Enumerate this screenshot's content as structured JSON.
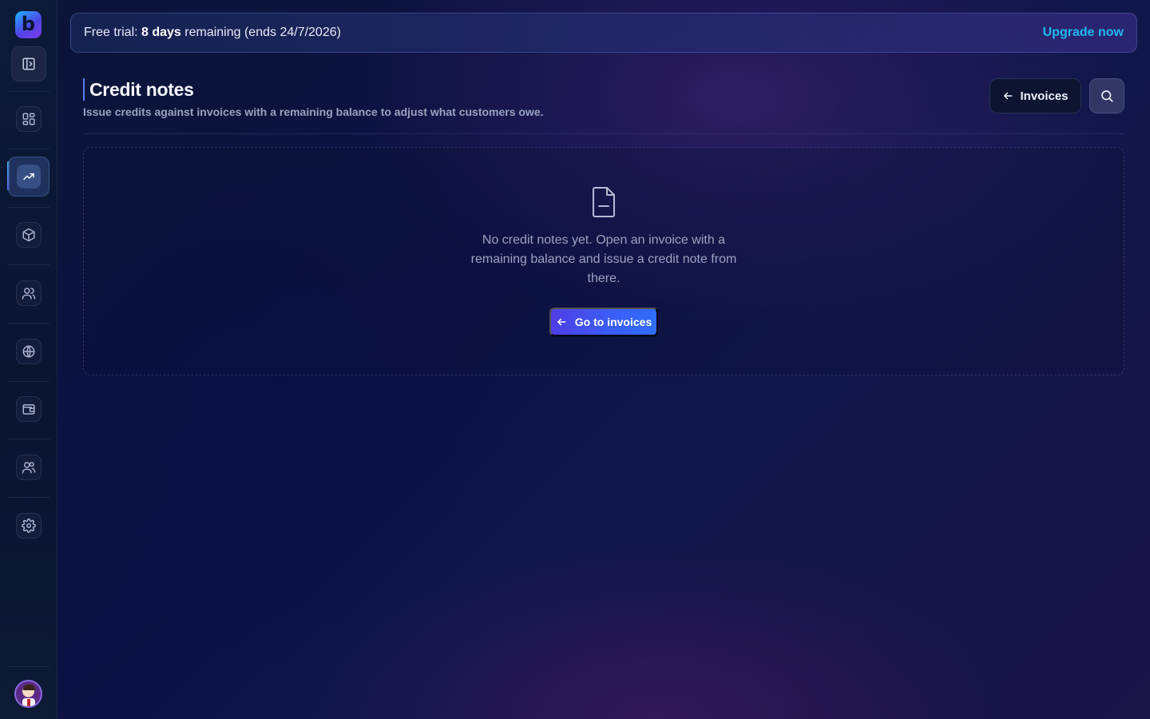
{
  "brand": {
    "logo_letter": "b"
  },
  "sidebar": {
    "items": [
      {
        "icon": "dashboard-icon"
      },
      {
        "icon": "trending-up-icon",
        "active": true
      },
      {
        "icon": "package-icon"
      },
      {
        "icon": "users-icon"
      },
      {
        "icon": "globe-icon"
      },
      {
        "icon": "wallet-icon"
      },
      {
        "icon": "team-icon"
      },
      {
        "icon": "settings-icon"
      }
    ]
  },
  "banner": {
    "prefix": "Free trial: ",
    "days": "8 days",
    "suffix": " remaining (ends 24/7/2026)",
    "upgrade_label": "Upgrade now"
  },
  "header": {
    "title": "Credit notes",
    "subtitle": "Issue credits against invoices with a remaining balance to adjust what customers owe.",
    "invoices_label": "Invoices"
  },
  "empty_state": {
    "message": "No credit notes yet. Open an invoice with a remaining balance and issue a credit note from there.",
    "button_label": "Go to invoices"
  },
  "colors": {
    "accent": "#22b8f0",
    "primary_button": "#3b5cf5"
  }
}
